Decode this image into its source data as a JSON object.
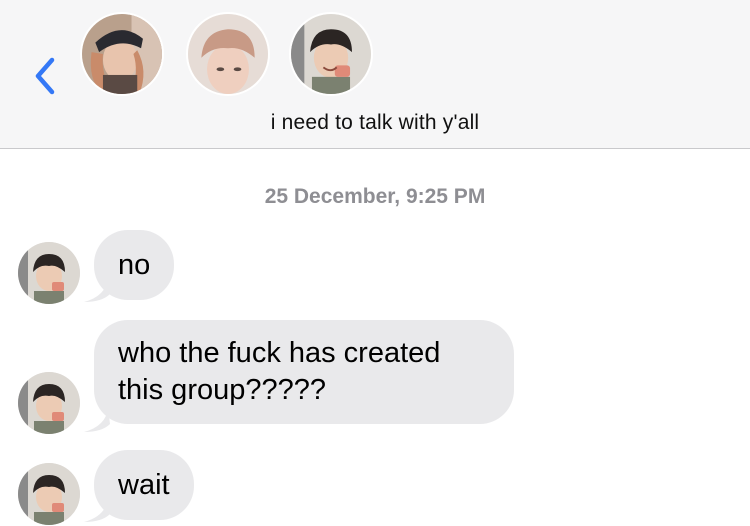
{
  "header": {
    "title": "i need to talk with y'all",
    "back_icon": "chevron-left-icon",
    "accent": "#3478f6",
    "participants": [
      "avatar-1",
      "avatar-2",
      "avatar-3"
    ]
  },
  "conversation": {
    "timestamp": "25 December, 9:25 PM",
    "messages": [
      {
        "text": "no"
      },
      {
        "line1": "who the fuck has created",
        "line2": "this group?????"
      },
      {
        "text": "wait"
      }
    ]
  },
  "colors": {
    "bubble": "#e9e9eb",
    "header_bg": "#f6f6f7",
    "timestamp": "#8e8e93"
  }
}
